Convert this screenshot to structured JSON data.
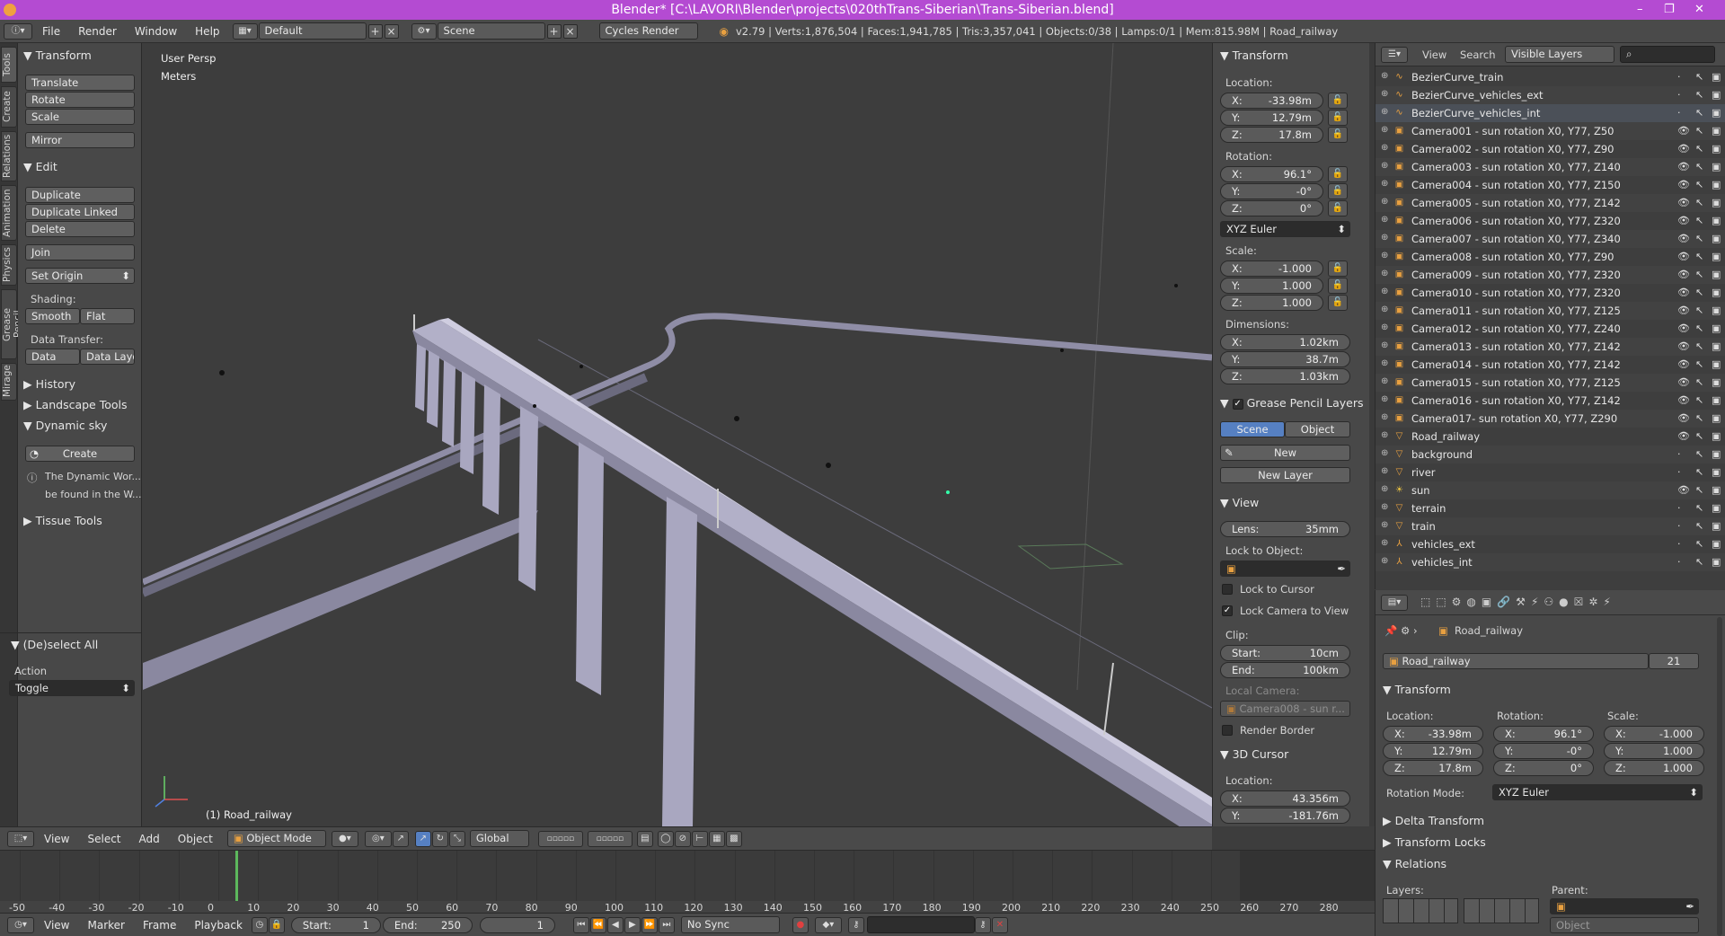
{
  "window": {
    "title": "Blender* [C:\\LAVORI\\Blender\\projects\\020thTrans-Siberian\\Trans-Siberian.blend]",
    "minimize": "–",
    "maximize": "❐",
    "close": "✕"
  },
  "info": {
    "menus": [
      "File",
      "Render",
      "Window",
      "Help"
    ],
    "layout": "Default",
    "scene": "Scene",
    "engine": "Cycles Render",
    "stats": "v2.79 | Verts:1,876,504 | Faces:1,941,785 | Tris:3,357,041 | Objects:0/38 | Lamps:0/1 | Mem:815.98M | Road_railway"
  },
  "tabs": [
    "Tools",
    "Create",
    "Relations",
    "Animation",
    "Physics",
    "Grease Pencil",
    "Mirage"
  ],
  "toolshelf": {
    "transform_title": "Transform",
    "translate": "Translate",
    "rotate": "Rotate",
    "scale": "Scale",
    "mirror": "Mirror",
    "edit_title": "Edit",
    "duplicate": "Duplicate",
    "duplicate_linked": "Duplicate Linked",
    "delete": "Delete",
    "join": "Join",
    "set_origin": "Set Origin",
    "shading_label": "Shading:",
    "smooth": "Smooth",
    "flat": "Flat",
    "data_transfer_label": "Data Transfer:",
    "data": "Data",
    "data_layo": "Data Layo",
    "history": "History",
    "landscape_tools": "Landscape Tools",
    "dynamic_sky": "Dynamic sky",
    "create": "Create",
    "info_line1": "The Dynamic Wor...",
    "info_line2": "be found in the W...",
    "tissue_tools": "Tissue Tools",
    "deselect_all": "(De)select All",
    "action_label": "Action",
    "action_value": "Toggle"
  },
  "viewport": {
    "view_name": "User Persp",
    "units": "Meters",
    "object_label": "(1) Road_railway"
  },
  "npanel": {
    "transform_title": "Transform",
    "location_label": "Location:",
    "location": [
      [
        "X:",
        "-33.98m"
      ],
      [
        "Y:",
        "12.79m"
      ],
      [
        "Z:",
        "17.8m"
      ]
    ],
    "rotation_label": "Rotation:",
    "rotation": [
      [
        "X:",
        "96.1°"
      ],
      [
        "Y:",
        "-0°"
      ],
      [
        "Z:",
        "0°"
      ]
    ],
    "rotation_mode": "XYZ Euler",
    "scale_label": "Scale:",
    "scale": [
      [
        "X:",
        "-1.000"
      ],
      [
        "Y:",
        "1.000"
      ],
      [
        "Z:",
        "1.000"
      ]
    ],
    "dimensions_label": "Dimensions:",
    "dimensions": [
      [
        "X:",
        "1.02km"
      ],
      [
        "Y:",
        "38.7m"
      ],
      [
        "Z:",
        "1.03km"
      ]
    ],
    "grease_title": "Grease Pencil Layers",
    "scene_tab": "Scene",
    "object_tab": "Object",
    "new": "New",
    "new_layer": "New Layer",
    "view_title": "View",
    "lens_label": "Lens:",
    "lens_value": "35mm",
    "lock_to_object": "Lock to Object:",
    "lock_to_cursor": "Lock to Cursor",
    "lock_camera": "Lock Camera to View",
    "clip_label": "Clip:",
    "clip_start_label": "Start:",
    "clip_start": "10cm",
    "clip_end_label": "End:",
    "clip_end": "100km",
    "local_camera": "Local Camera:",
    "local_camera_value": "Camera008 - sun r...",
    "render_border": "Render Border",
    "cursor_title": "3D Cursor",
    "cursor_location_label": "Location:",
    "cursor": [
      [
        "X:",
        "43.356m"
      ],
      [
        "Y:",
        "-181.76m"
      ]
    ]
  },
  "outliner": {
    "view": "View",
    "search": "Search",
    "display": "Visible Layers",
    "items": [
      {
        "name": "BezierCurve_train",
        "icon": "curve-icon",
        "visible": false
      },
      {
        "name": "BezierCurve_vehicles_ext",
        "icon": "curve-icon",
        "visible": false
      },
      {
        "name": "BezierCurve_vehicles_int",
        "icon": "curve-icon",
        "visible": false
      },
      {
        "name": "Camera001 - sun rotation X0, Y77, Z50",
        "icon": "camera-icon",
        "visible": true
      },
      {
        "name": "Camera002 - sun rotation X0, Y77, Z90",
        "icon": "camera-icon",
        "visible": true
      },
      {
        "name": "Camera003 - sun rotation X0, Y77, Z140",
        "icon": "camera-icon",
        "visible": true
      },
      {
        "name": "Camera004 - sun rotation X0, Y77, Z150",
        "icon": "camera-icon",
        "visible": true
      },
      {
        "name": "Camera005 - sun rotation X0, Y77, Z142",
        "icon": "camera-icon",
        "visible": true
      },
      {
        "name": "Camera006 - sun rotation X0, Y77, Z320",
        "icon": "camera-icon",
        "visible": true
      },
      {
        "name": "Camera007 - sun rotation X0, Y77, Z340",
        "icon": "camera-icon",
        "visible": true
      },
      {
        "name": "Camera008 - sun rotation X0, Y77, Z90",
        "icon": "camera-icon",
        "visible": true
      },
      {
        "name": "Camera009 - sun rotation X0, Y77, Z320",
        "icon": "camera-icon",
        "visible": true
      },
      {
        "name": "Camera010 - sun rotation X0, Y77, Z320",
        "icon": "camera-icon",
        "visible": true
      },
      {
        "name": "Camera011 - sun rotation X0, Y77, Z125",
        "icon": "camera-icon",
        "visible": true
      },
      {
        "name": "Camera012 - sun rotation X0, Y77, Z240",
        "icon": "camera-icon",
        "visible": true
      },
      {
        "name": "Camera013 - sun rotation X0, Y77, Z142",
        "icon": "camera-icon",
        "visible": true
      },
      {
        "name": "Camera014 - sun rotation X0, Y77, Z142",
        "icon": "camera-icon",
        "visible": true
      },
      {
        "name": "Camera015 - sun rotation X0, Y77, Z125",
        "icon": "camera-icon",
        "visible": true
      },
      {
        "name": "Camera016 - sun rotation X0, Y77, Z142",
        "icon": "camera-icon",
        "visible": true
      },
      {
        "name": "Camera017- sun rotation X0, Y77, Z290",
        "icon": "camera-icon",
        "visible": true
      },
      {
        "name": "Road_railway",
        "icon": "mesh-icon",
        "visible": true
      },
      {
        "name": "background",
        "icon": "mesh-icon",
        "visible": false
      },
      {
        "name": "river",
        "icon": "mesh-icon",
        "visible": false
      },
      {
        "name": "sun",
        "icon": "lamp-icon",
        "visible": true
      },
      {
        "name": "terrain",
        "icon": "mesh-icon",
        "visible": false
      },
      {
        "name": "train",
        "icon": "mesh-icon",
        "visible": false
      },
      {
        "name": "vehicles_ext",
        "icon": "armature-icon",
        "visible": false
      },
      {
        "name": "vehicles_int",
        "icon": "armature-icon",
        "visible": false
      }
    ]
  },
  "properties": {
    "breadcrumb": "Road_railway",
    "object_name": "Road_railway",
    "users": "21",
    "transform_title": "Transform",
    "location_label": "Location:",
    "rotation_label": "Rotation:",
    "scale_label": "Scale:",
    "location": [
      [
        "X:",
        "-33.98m"
      ],
      [
        "Y:",
        "12.79m"
      ],
      [
        "Z:",
        "17.8m"
      ]
    ],
    "rotation": [
      [
        "X:",
        "96.1°"
      ],
      [
        "Y:",
        "-0°"
      ],
      [
        "Z:",
        "0°"
      ]
    ],
    "scale": [
      [
        "X:",
        "-1.000"
      ],
      [
        "Y:",
        "1.000"
      ],
      [
        "Z:",
        "1.000"
      ]
    ],
    "rotation_mode_label": "Rotation Mode:",
    "rotation_mode": "XYZ Euler",
    "delta_transform": "Delta Transform",
    "transform_locks": "Transform Locks",
    "relations": "Relations",
    "layers_label": "Layers:",
    "parent_label": "Parent:",
    "parent_type": "Object"
  },
  "vpheader": {
    "menus": [
      "View",
      "Select",
      "Add",
      "Object"
    ],
    "mode": "Object Mode",
    "orientation": "Global"
  },
  "timeline": {
    "ticks": [
      "-50",
      "-40",
      "-30",
      "-20",
      "-10",
      "0",
      "10",
      "20",
      "30",
      "40",
      "50",
      "60",
      "70",
      "80",
      "90",
      "100",
      "110",
      "120",
      "130",
      "140",
      "150",
      "160",
      "170",
      "180",
      "190",
      "200",
      "210",
      "220",
      "230",
      "240",
      "250",
      "260",
      "270",
      "280"
    ],
    "current_frame": 1
  },
  "tlheader": {
    "menus": [
      "View",
      "Marker",
      "Frame",
      "Playback"
    ],
    "start_label": "Start:",
    "start": "1",
    "end_label": "End:",
    "end": "250",
    "frame": "1",
    "sync": "No Sync"
  },
  "colors": {
    "titlebar": "#b44bd2",
    "selection_blue": "#5680c2",
    "current_frame": "#5cb85c",
    "bridge": "#a8a6bf"
  }
}
